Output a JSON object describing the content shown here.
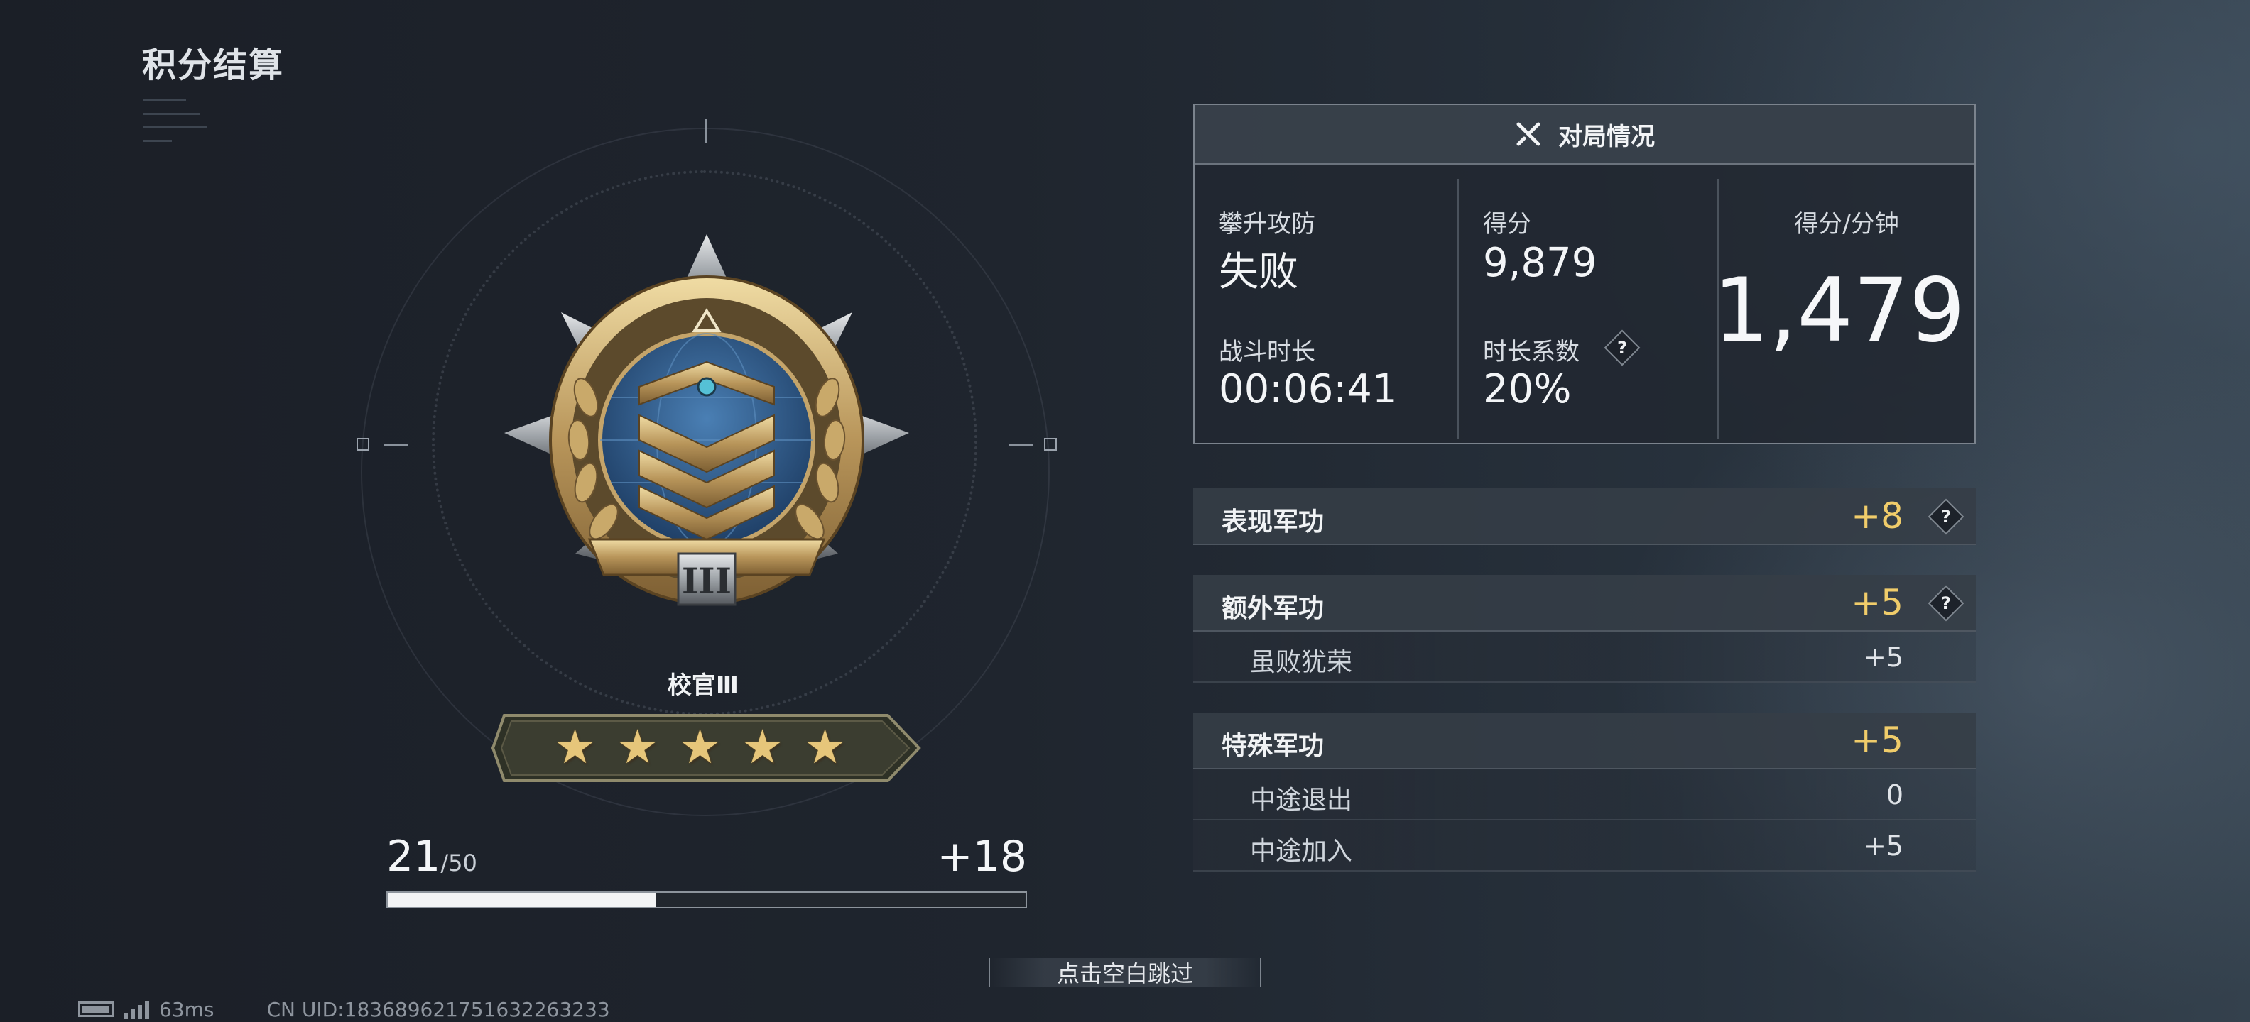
{
  "title": "积分结算",
  "rank": {
    "name": "校官Ⅲ",
    "tier_numeral": "III",
    "stars_filled": 5,
    "stars_total": 5,
    "progress_current": "21",
    "progress_max": "/50",
    "progress_fraction": 0.42,
    "progress_gain": "+18"
  },
  "match": {
    "header": "对局情况",
    "mode_label": "攀升攻防",
    "mode_result": "失败",
    "score_label": "得分",
    "score_value": "9,879",
    "duration_label": "战斗时长",
    "duration_value": "00:06:41",
    "coef_label": "时长系数",
    "coef_value": "20%",
    "spm_label": "得分/分钟",
    "spm_value": "1,479"
  },
  "merits": {
    "performance": {
      "label": "表现军功",
      "value": "+8"
    },
    "extra": {
      "label": "额外军功",
      "value": "+5",
      "items": [
        {
          "label": "虽败犹荣",
          "value": "+5"
        }
      ]
    },
    "special": {
      "label": "特殊军功",
      "value": "+5",
      "items": [
        {
          "label": "中途退出",
          "value": "0"
        },
        {
          "label": "中途加入",
          "value": "+5"
        }
      ]
    }
  },
  "help_symbol": "?",
  "skip_hint": "点击空白跳过",
  "status": {
    "ping": "63ms",
    "uid": "CN UID:183689621751632263233"
  },
  "colors": {
    "merit_value": "#f0cc6a",
    "star_gold": "#e6c67a",
    "emblem_blue": "#2f5d8c"
  },
  "icons": [
    "crossed-swords-icon",
    "battery-icon",
    "signal-icon",
    "question-icon",
    "star-icon"
  ]
}
